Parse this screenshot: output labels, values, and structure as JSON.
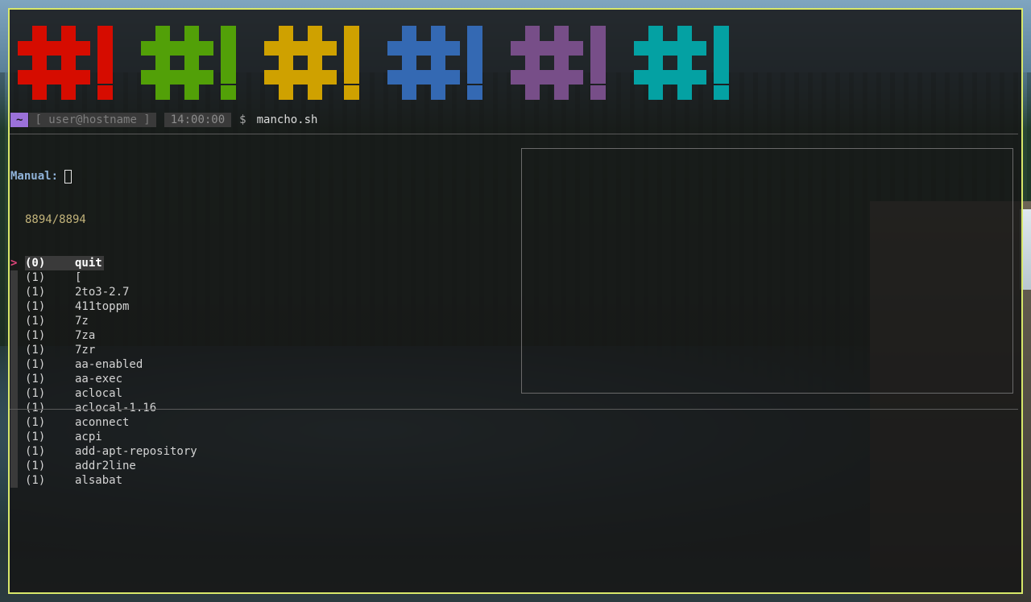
{
  "banner": {
    "logos": [
      {
        "color": "#d60c00",
        "icon": "hashbang-icon"
      },
      {
        "color": "#52a008",
        "icon": "hashbang-icon"
      },
      {
        "color": "#cfa100",
        "icon": "hashbang-icon"
      },
      {
        "color": "#3469b3",
        "icon": "hashbang-icon"
      },
      {
        "color": "#774e88",
        "icon": "hashbang-icon"
      },
      {
        "color": "#04a1a3",
        "icon": "hashbang-icon"
      }
    ]
  },
  "prompt": {
    "dir": "~",
    "user_host": "[ user@hostname ]",
    "time": "14:00:00",
    "symbol": "$",
    "command": "mancho.sh"
  },
  "fzf": {
    "query_label": "Manual:",
    "query_value": "",
    "count": "8894/8894",
    "pointer": ">",
    "items": [
      {
        "section": "(0)",
        "name": "quit",
        "selected": true
      },
      {
        "section": "(1)",
        "name": "["
      },
      {
        "section": "(1)",
        "name": "2to3-2.7"
      },
      {
        "section": "(1)",
        "name": "411toppm"
      },
      {
        "section": "(1)",
        "name": "7z"
      },
      {
        "section": "(1)",
        "name": "7za"
      },
      {
        "section": "(1)",
        "name": "7zr"
      },
      {
        "section": "(1)",
        "name": "aa-enabled"
      },
      {
        "section": "(1)",
        "name": "aa-exec"
      },
      {
        "section": "(1)",
        "name": "aclocal"
      },
      {
        "section": "(1)",
        "name": "aclocal-1.16"
      },
      {
        "section": "(1)",
        "name": "aconnect"
      },
      {
        "section": "(1)",
        "name": "acpi"
      },
      {
        "section": "(1)",
        "name": "add-apt-repository"
      },
      {
        "section": "(1)",
        "name": "addr2line"
      },
      {
        "section": "(1)",
        "name": "alsabat"
      }
    ]
  },
  "colors": {
    "window_border": "#d8e86a",
    "tilde_bg": "#9b71d9",
    "pointer": "#e0457b",
    "count": "#c2b37a",
    "query_label": "#8fb2d8"
  }
}
